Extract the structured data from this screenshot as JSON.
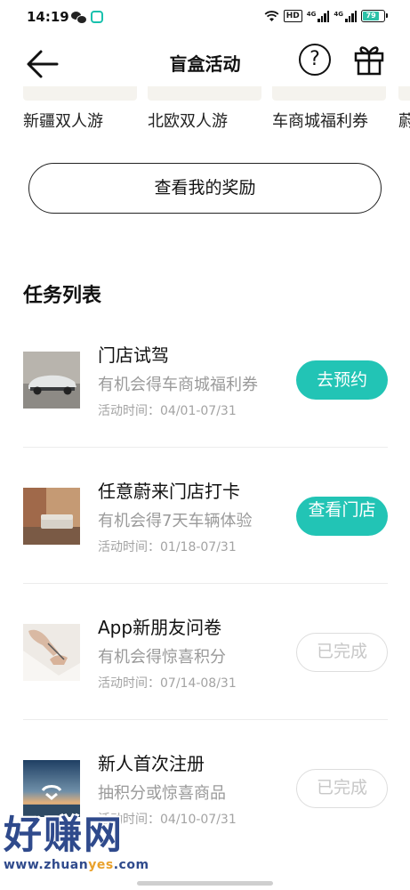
{
  "status_bar": {
    "time": "14:19",
    "hd": "HD",
    "signal_1": "4G",
    "signal_2": "4G",
    "battery": "79"
  },
  "header": {
    "title": "盲盒活动",
    "back_icon": "arrow-left-icon",
    "help_icon": "question-circle-icon",
    "gift_icon": "gift-icon"
  },
  "rewards": [
    {
      "label": "新疆双人游"
    },
    {
      "label": "北欧双人游"
    },
    {
      "label": "车商城福利券"
    },
    {
      "label": "蔚"
    }
  ],
  "my_rewards_button": "查看我的奖励",
  "task_section": {
    "title": "任务列表",
    "tasks": [
      {
        "title": "门店试驾",
        "desc": "有机会得车商城福利券",
        "time": "活动时间：04/01-07/31",
        "action": "去预约",
        "action_state": "primary"
      },
      {
        "title": "任意蔚来门店打卡",
        "desc": "有机会得7天车辆体验",
        "time": "活动时间：01/18-07/31",
        "action": "查看门店",
        "action_state": "primary"
      },
      {
        "title": "App新朋友问卷",
        "desc": "有机会得惊喜积分",
        "time": "活动时间：07/14-08/31",
        "action": "已完成",
        "action_state": "done"
      },
      {
        "title": "新人首次注册",
        "desc": "抽积分或惊喜商品",
        "time": "活动时间：04/10-07/31",
        "action": "已完成",
        "action_state": "done"
      }
    ]
  },
  "watermark": {
    "big": "好赚网",
    "small_a": "www.zhuan",
    "small_b": "yes",
    "small_c": ".com"
  },
  "colors": {
    "accent": "#22c4b5",
    "done_border": "#dddddd",
    "muted_text": "#9a9a9a"
  }
}
